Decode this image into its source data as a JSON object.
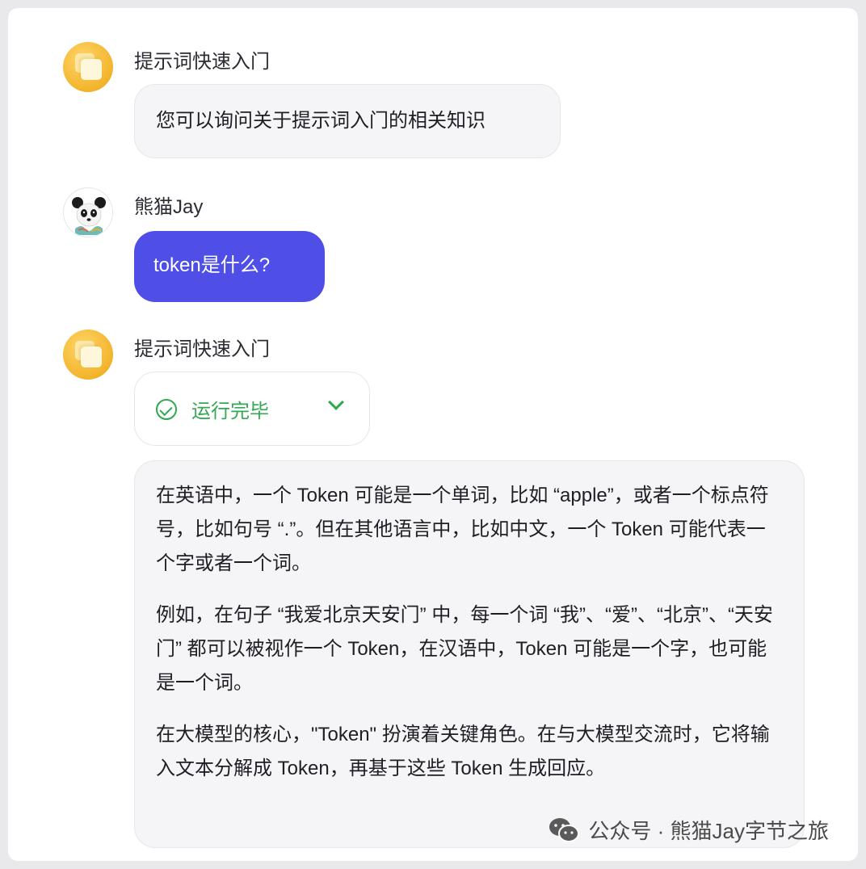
{
  "messages": [
    {
      "sender": "提示词快速入门",
      "avatar_icon": "stacked-cards-icon",
      "text": "您可以询问关于提示词入门的相关知识"
    },
    {
      "sender": "熊猫Jay",
      "avatar_icon": "panda-avatar",
      "text": "token是什么?"
    },
    {
      "sender": "提示词快速入门",
      "avatar_icon": "stacked-cards-icon",
      "status_label": "运行完毕",
      "paragraphs": [
        "在英语中，一个 Token 可能是一个单词，比如 “apple”，或者一个标点符号，比如句号 “.”。但在其他语言中，比如中文，一个 Token 可能代表一个字或者一个词。",
        "例如，在句子 “我爱北京天安门” 中，每一个词 “我”、“爱”、“北京”、“天安门” 都可以被视作一个 Token，在汉语中，Token 可能是一个字，也可能是一个词。",
        "在大模型的核心，\"Token\" 扮演着关键角色。在与大模型交流时，它将输入文本分解成 Token，再基于这些 Token 生成回应。"
      ]
    }
  ],
  "watermark": "公众号 · 熊猫Jay字节之旅",
  "colors": {
    "user_bubble": "#4f4fe8",
    "status_green": "#34a853",
    "bot_avatar": "#f2b42b"
  }
}
